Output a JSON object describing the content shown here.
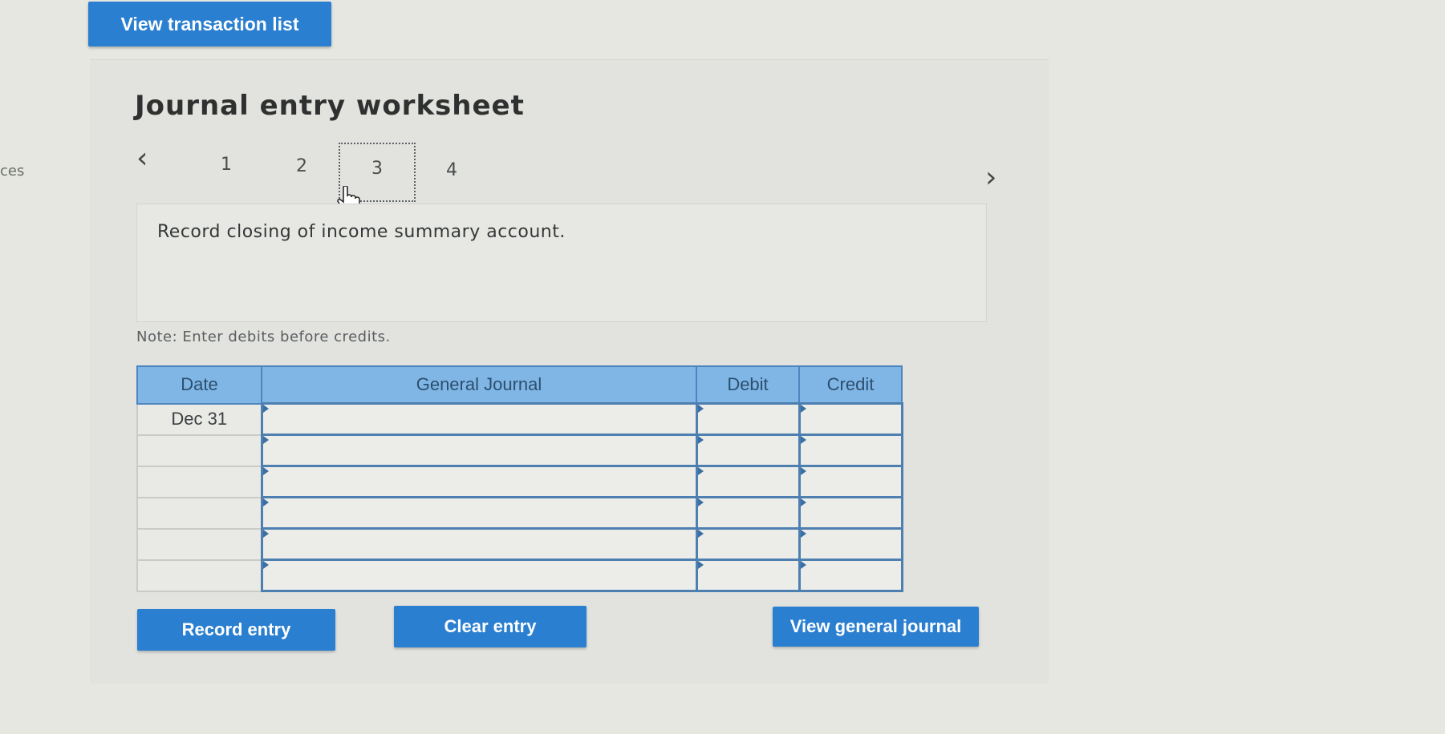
{
  "edge_fragment": "ces",
  "top_button": {
    "label": "View transaction list"
  },
  "worksheet": {
    "title": "Journal entry worksheet",
    "steps": [
      "1",
      "2",
      "3",
      "4"
    ],
    "active_step": "3",
    "task": "Record closing of income summary account.",
    "note": "Note: Enter debits before credits."
  },
  "table": {
    "headers": {
      "date": "Date",
      "general_journal": "General Journal",
      "debit": "Debit",
      "credit": "Credit"
    },
    "rows": [
      {
        "date": "Dec 31",
        "account": "",
        "debit": "",
        "credit": ""
      },
      {
        "date": "",
        "account": "",
        "debit": "",
        "credit": ""
      },
      {
        "date": "",
        "account": "",
        "debit": "",
        "credit": ""
      },
      {
        "date": "",
        "account": "",
        "debit": "",
        "credit": ""
      },
      {
        "date": "",
        "account": "",
        "debit": "",
        "credit": ""
      },
      {
        "date": "",
        "account": "",
        "debit": "",
        "credit": ""
      }
    ]
  },
  "buttons": {
    "record": "Record entry",
    "clear": "Clear entry",
    "view_journal": "View general journal"
  },
  "colors": {
    "button_blue": "#2b7fd0",
    "header_blue": "#7fb6e6",
    "input_border": "#4d7fb0"
  },
  "icons": {
    "prev": "chevron-left-icon",
    "next": "chevron-right-icon",
    "cursor": "hand-pointer-icon"
  }
}
